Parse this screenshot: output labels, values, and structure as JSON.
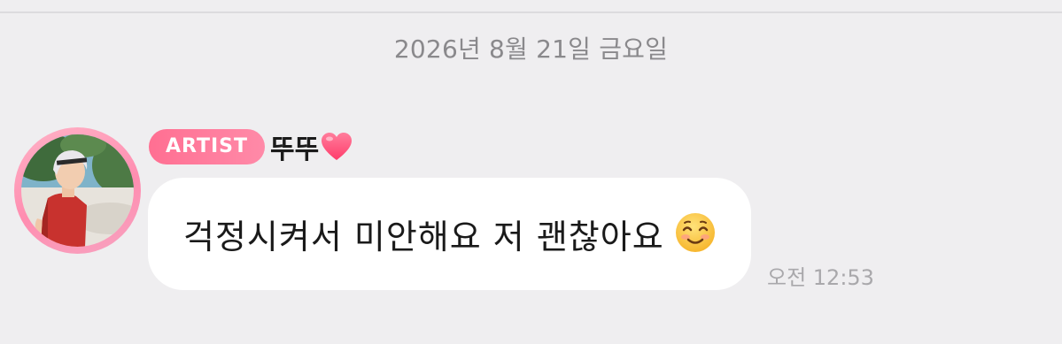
{
  "date_separator": "2026년 8월 21일 금요일",
  "message": {
    "badge": "ARTIST",
    "sender": "뚜뚜",
    "sender_icon": "heart-icon",
    "text": "걱정시켜서 미안해요 저 괜찮아요",
    "text_emoji": "smiling-face-icon",
    "time": "오전 12:53"
  },
  "colors": {
    "background": "#efeef0",
    "badge": "#ff7a9a",
    "avatar_ring": "#ff8db0",
    "bubble": "#ffffff",
    "timestamp": "#a9a8ab",
    "heart": "#ff4f7b"
  }
}
